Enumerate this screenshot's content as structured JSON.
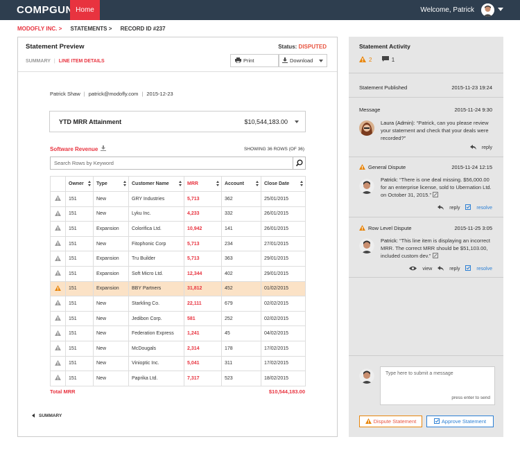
{
  "app": {
    "logo": "COMPGUN",
    "home_tab": "Home",
    "welcome": "Welcome, Patrick"
  },
  "breadcrumb": {
    "items": [
      "MODOFLY INC. >",
      "STATEMENTS >",
      "RECORD ID #237"
    ]
  },
  "statement": {
    "title": "Statement Preview",
    "status_label": "Status:",
    "status_value": "DISPUTED",
    "tabs": [
      "SUMMARY",
      "LINE ITEM DETAILS"
    ],
    "print_label": "Print",
    "download_label": "Download",
    "person": "Patrick Shaw",
    "email": "patrick@modofly.com",
    "date": "2015-12-23",
    "ytd_label": "YTD MRR Attainment",
    "ytd_value": "$10,544,183.00",
    "section_title": "Software Revenue",
    "showing": "SHOWING 36 ROWS (OF 36)",
    "search_placeholder": "Search Rows by Keyword",
    "columns": [
      "Owner",
      "Type",
      "Customer Name",
      "MRR",
      "Account",
      "Close Date"
    ],
    "rows": [
      {
        "owner": "151",
        "type": "New",
        "customer": "GRY Industries",
        "mrr": "5,713",
        "account": "362",
        "close": "25/01/2015",
        "highlight": false
      },
      {
        "owner": "151",
        "type": "New",
        "customer": "Lyku Inc.",
        "mrr": "4,233",
        "account": "332",
        "close": "26/01/2015",
        "highlight": false
      },
      {
        "owner": "151",
        "type": "Expansion",
        "customer": "Colorifica Ltd.",
        "mrr": "10,942",
        "account": "141",
        "close": "26/01/2015",
        "highlight": false
      },
      {
        "owner": "151",
        "type": "New",
        "customer": "Fitophonic Corp",
        "mrr": "5,713",
        "account": "234",
        "close": "27/01/2015",
        "highlight": false
      },
      {
        "owner": "151",
        "type": "Expansion",
        "customer": "Tru Builder",
        "mrr": "5,713",
        "account": "363",
        "close": "29/01/2015",
        "highlight": false
      },
      {
        "owner": "151",
        "type": "Expansion",
        "customer": "Soft Micro Ltd.",
        "mrr": "12,344",
        "account": "402",
        "close": "29/01/2015",
        "highlight": false
      },
      {
        "owner": "151",
        "type": "Expansion",
        "customer": "BBY Partners",
        "mrr": "31,812",
        "account": "452",
        "close": "01/02/2015",
        "highlight": true
      },
      {
        "owner": "151",
        "type": "New",
        "customer": "Starkling Co.",
        "mrr": "22,111",
        "account": "679",
        "close": "02/02/2015",
        "highlight": false
      },
      {
        "owner": "151",
        "type": "New",
        "customer": "Jedibon Corp.",
        "mrr": "581",
        "account": "252",
        "close": "02/02/2015",
        "highlight": false
      },
      {
        "owner": "151",
        "type": "New",
        "customer": "Federation Express",
        "mrr": "1,241",
        "account": "45",
        "close": "04/02/2015",
        "highlight": false
      },
      {
        "owner": "151",
        "type": "New",
        "customer": "McDougals",
        "mrr": "2,314",
        "account": "178",
        "close": "17/02/2015",
        "highlight": false
      },
      {
        "owner": "151",
        "type": "New",
        "customer": "Vinioptic Inc.",
        "mrr": "5,041",
        "account": "311",
        "close": "17/02/2015",
        "highlight": false
      },
      {
        "owner": "151",
        "type": "New",
        "customer": "Paprika Ltd.",
        "mrr": "7,317",
        "account": "523",
        "close": "18/02/2015",
        "highlight": false
      }
    ],
    "total_label": "Total MRR",
    "total_value": "$10,544,183.00",
    "summary_link": "SUMMARY"
  },
  "activity": {
    "title": "Statement Activity",
    "warn_count": "2",
    "msg_count": "1",
    "published_label": "Statement Published",
    "published_time": "2015-11-23 19:24",
    "message_label": "Message",
    "message_time": "2015-11-24 9:30",
    "message_author": "Laura (Admin):",
    "message_text": "“Patrick, can you please review your statement and check that your deals were recorded?”",
    "general_label": "General Dispute",
    "general_time": "2015-11-24 12:15",
    "general_author": "Patrick:",
    "general_text": "“There is one deal missing. $56,000.00 for an enterprise license, sold to Ubernation Ltd. on October 31, 2015.”",
    "row_label": "Row Level Dispute",
    "row_time": "2015-11-25 3:05",
    "row_author": "Patrick:",
    "row_text": "“This line item is displaying an incorrect MRR.  The correct MRR should be $51,103.00, included custom dev.”",
    "view_label": "view",
    "reply_label": "reply",
    "resolve_label": "resolve",
    "compose_placeholder": "Type here to submit a message",
    "compose_hint": "press enter to send",
    "dispute_button": "Dispute Statement",
    "approve_button": "Approve Statement"
  },
  "colors": {
    "topbar": "#2e3e4f",
    "accent_red": "#e8333f",
    "warning_orange": "#e8850b",
    "link_blue": "#2b7fd4",
    "highlight_row": "#fbe2c6"
  }
}
